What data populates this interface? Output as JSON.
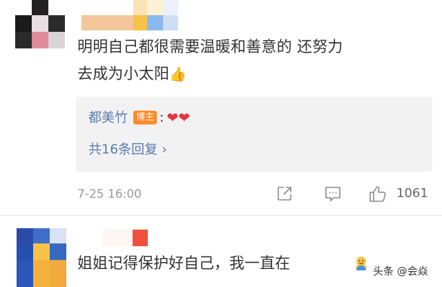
{
  "comment1": {
    "text_line1": "明明自己都很需要温暖和善意的 还努力",
    "text_line2": "去成为小太阳",
    "text_emoji": "👍",
    "reply": {
      "author": "都美竹",
      "badge": "博主",
      "colon": ":",
      "hearts": "❤❤",
      "count_text": "共16条回复",
      "chevron": "›"
    },
    "time": "7-25 16:00",
    "like_count": "1061",
    "icons": [
      "share-icon",
      "comment-icon",
      "like-icon"
    ]
  },
  "comment2": {
    "text": "姐姐记得保护好自己，我一直在",
    "emoji": "hug-emoji"
  },
  "watermark": "头条 @会焱",
  "colors": {
    "link": "#5b7bb0",
    "badge": "#ff8b29",
    "heart": "#e8313c",
    "reply_bg": "#f2f2f2",
    "meta": "#999999"
  }
}
